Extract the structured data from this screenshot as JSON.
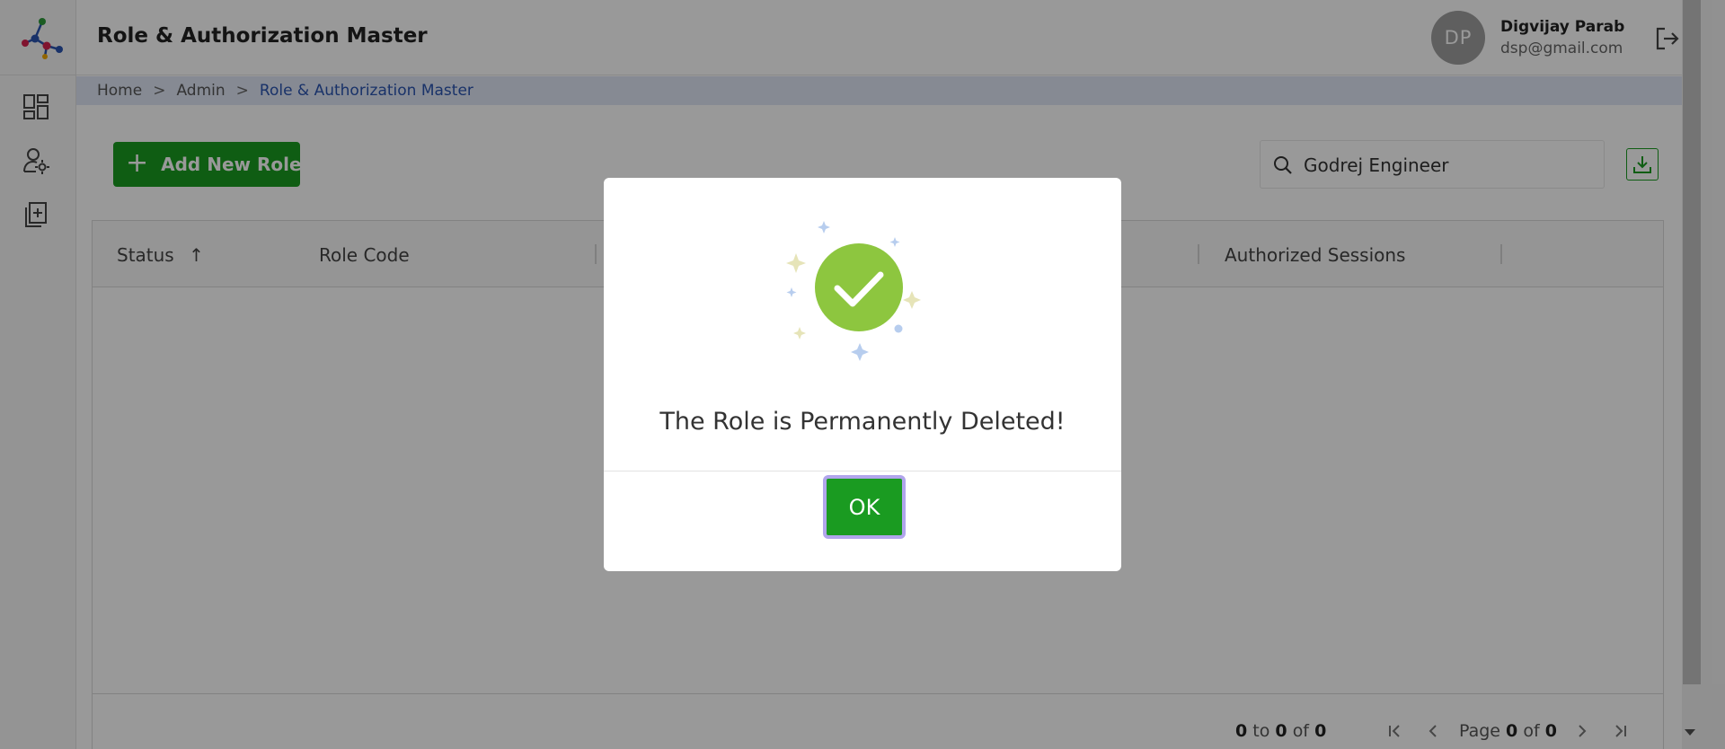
{
  "header": {
    "title": "Role & Authorization Master",
    "user": {
      "initials": "DP",
      "name": "Digvijay Parab",
      "email": "dsp@gmail.com"
    }
  },
  "breadcrumb": {
    "items": [
      "Home",
      "Admin",
      "Role & Authorization Master"
    ],
    "separator": ">"
  },
  "toolbar": {
    "add_label": "Add New Role",
    "search_value": "Godrej Engineer"
  },
  "grid": {
    "columns": [
      "Status",
      "Role Code",
      "Authorized Sessions"
    ],
    "sort_indicator": "↑",
    "footer": {
      "from": "0",
      "to_word": "to",
      "to": "0",
      "of_word": "of",
      "total": "0",
      "page_word": "Page",
      "page": "0",
      "page_of": "of",
      "page_total": "0"
    }
  },
  "modal": {
    "message": "The Role is Permanently Deleted!",
    "ok_label": "OK"
  },
  "icons": {
    "logo": "logo-icon",
    "nav": [
      "dashboard-icon",
      "user-settings-icon",
      "add-document-icon"
    ],
    "logout": "logout-icon",
    "search": "search-icon",
    "download": "download-icon",
    "success": "check-circle-icon"
  },
  "colors": {
    "primary_green": "#1a9b21",
    "breadcrumb_active": "#2a54b0",
    "breadcrumb_bg": "#dfe6f5",
    "success_circle": "#8dc63f",
    "ok_focus_ring": "#b1a5ec"
  }
}
